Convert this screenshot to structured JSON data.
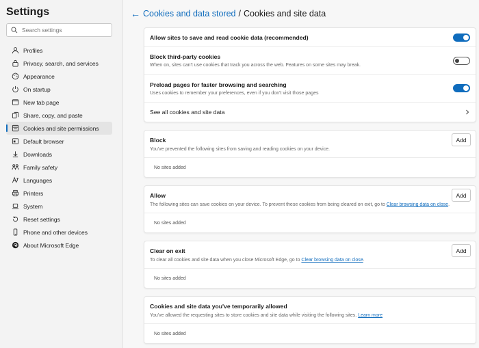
{
  "sidebar": {
    "title": "Settings",
    "search_placeholder": "Search settings",
    "items": [
      {
        "label": "Profiles"
      },
      {
        "label": "Privacy, search, and services"
      },
      {
        "label": "Appearance"
      },
      {
        "label": "On startup"
      },
      {
        "label": "New tab page"
      },
      {
        "label": "Share, copy, and paste"
      },
      {
        "label": "Cookies and site permissions"
      },
      {
        "label": "Default browser"
      },
      {
        "label": "Downloads"
      },
      {
        "label": "Family safety"
      },
      {
        "label": "Languages"
      },
      {
        "label": "Printers"
      },
      {
        "label": "System"
      },
      {
        "label": "Reset settings"
      },
      {
        "label": "Phone and other devices"
      },
      {
        "label": "About Microsoft Edge"
      }
    ],
    "active_item": "Cookies and site permissions"
  },
  "header": {
    "back_icon": "arrow-left-icon",
    "crumb": "Cookies and data stored",
    "separator": "/",
    "title": "Cookies and site data"
  },
  "settings": {
    "allow_sites": {
      "title": "Allow sites to save and read cookie data (recommended)",
      "enabled": true
    },
    "block_third_party": {
      "title": "Block third-party cookies",
      "desc": "When on, sites can't use cookies that track you across the web. Features on some sites may break.",
      "enabled": false
    },
    "preload": {
      "title": "Preload pages for faster browsing and searching",
      "desc": "Uses cookies to remember your preferences, even if you don't visit those pages",
      "enabled": true
    },
    "see_all": {
      "title": "See all cookies and site data"
    }
  },
  "sections": {
    "block": {
      "title": "Block",
      "desc": "You've prevented the following sites from saving and reading cookies on your device.",
      "add_label": "Add",
      "empty": "No sites added"
    },
    "allow": {
      "title": "Allow",
      "desc": "The following sites can save cookies on your device. To prevent these cookies from being cleared on exit, go to ",
      "link": "Clear browsing data on close",
      "desc_end": ".",
      "add_label": "Add",
      "empty": "No sites added"
    },
    "clear_on_exit": {
      "title": "Clear on exit",
      "desc": "To clear all cookies and site data when you close Microsoft Edge, go to ",
      "link": "Clear browsing data on close",
      "desc_end": ".",
      "add_label": "Add",
      "empty": "No sites added"
    },
    "temp_allowed": {
      "title": "Cookies and site data you've temporarily allowed",
      "desc": "You've allowed the requesting sites to store cookies and site data while visiting the following sites. ",
      "link": "Learn more",
      "empty": "No sites added"
    }
  },
  "colors": {
    "accent": "#0f6cbd"
  }
}
